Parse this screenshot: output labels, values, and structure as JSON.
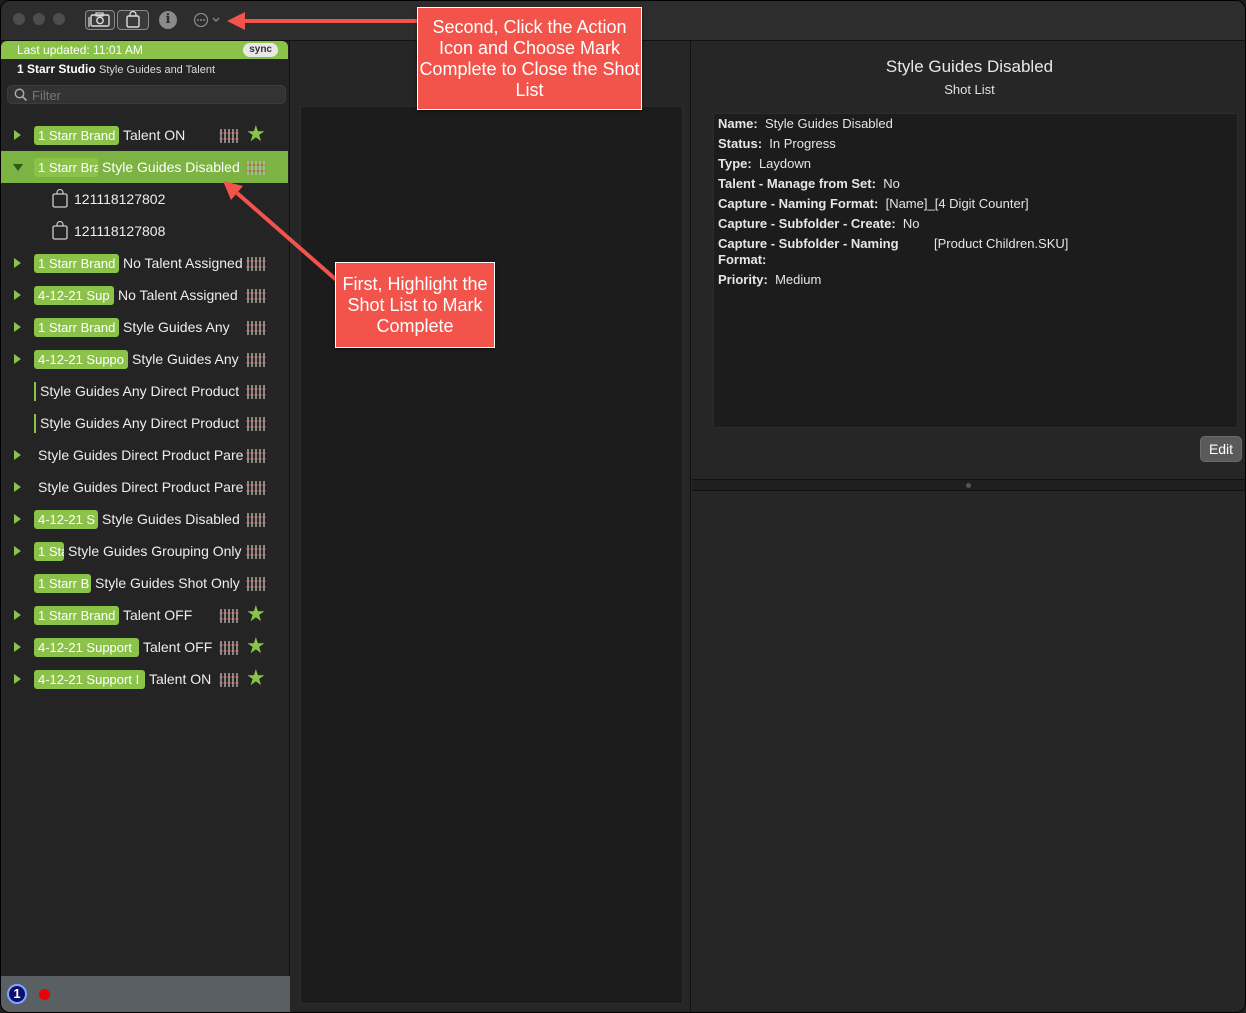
{
  "toolbar": {
    "capture_icon": "camera-icon",
    "product_icon": "shopping-bag-icon",
    "info_icon": "info-icon",
    "info_glyph": "i",
    "action_icon": "action-ellipsis-icon"
  },
  "sidebar": {
    "last_updated": "Last updated: 11:01 AM",
    "sync_label": "sync",
    "studio_name": "1 Starr Studio",
    "studio_sub": "Style Guides and Talent",
    "filter_placeholder": "Filter",
    "rows": [
      {
        "badge": "1 Starr Brand",
        "title": "Talent ON",
        "star": true
      },
      {
        "badge": "1 Starr Bra",
        "title": "Style Guides Disabled",
        "selected": true,
        "expanded": true
      },
      {
        "child": "121118127802"
      },
      {
        "child": "121118127808"
      },
      {
        "badge": "1 Starr Brand",
        "title": "No Talent Assigned"
      },
      {
        "badge": "4-12-21 Sup",
        "title": "No Talent Assigned"
      },
      {
        "badge": "1 Starr Brand",
        "title": "Style Guides Any"
      },
      {
        "badge": "4-12-21 Suppo",
        "title": "Style Guides Any"
      },
      {
        "title": "Style Guides Any Direct Product"
      },
      {
        "title": "Style Guides Any Direct Product"
      },
      {
        "title": "Style Guides Direct Product Pare"
      },
      {
        "title": "Style Guides Direct Product Pare"
      },
      {
        "badge": "4-12-21 S",
        "title": "Style Guides Disabled"
      },
      {
        "badge": "1 Sta",
        "title": "Style Guides Grouping Only"
      },
      {
        "badge": "1 Starr B",
        "title": "Style Guides Shot Only"
      },
      {
        "badge": "1 Starr Brand",
        "title": "Talent OFF",
        "star": true
      },
      {
        "badge": "4-12-21 Support",
        "title": "Talent OFF",
        "star": true
      },
      {
        "badge": "4-12-21 Support I",
        "title": "Talent ON",
        "star": true
      }
    ],
    "footer_badge": "1"
  },
  "detail": {
    "title": "Style Guides Disabled",
    "subtitle": "Shot List",
    "fields": {
      "name_label": "Name:",
      "name_value": "Style Guides Disabled",
      "status_label": "Status:",
      "status_value": "In Progress",
      "type_label": "Type:",
      "type_value": "Laydown",
      "talent_label": "Talent - Manage from Set:",
      "talent_value": "No",
      "naming_label": "Capture - Naming Format:",
      "naming_value": "[Name]_[4 Digit Counter]",
      "subcreate_label": "Capture - Subfolder - Create:",
      "subcreate_value": "No",
      "subnaming_label": "Capture - Subfolder - Naming",
      "subnaming_label2": "Format:",
      "subnaming_value": "[Product Children.SKU]",
      "priority_label": "Priority:",
      "priority_value": "Medium"
    },
    "edit_label": "Edit"
  },
  "callouts": {
    "first": "First, Highlight the Shot List to Mark Complete",
    "second": "Second, Click the Action Icon and Choose Mark Complete to Close the Shot List"
  },
  "colors": {
    "accent_green": "#8bc34a",
    "selected_green": "#7cb342",
    "callout_red": "#f2544b",
    "record_red": "#ee0000"
  }
}
